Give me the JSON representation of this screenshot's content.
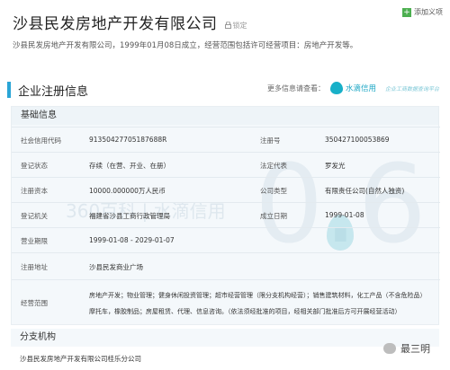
{
  "header": {
    "title": "沙县民发房地产开发有限公司",
    "lock_label": "锁定",
    "add_button": "添加义项",
    "intro": "沙县民发房地产开发有限公司，1999年01月08日成立，经营范围包括许可经营项目：房地产开发等。"
  },
  "section": {
    "title": "企业注册信息",
    "more_label": "更多信息请查看：",
    "brand": "水滴信用",
    "slogan": "企业工商数据查询平台"
  },
  "card": {
    "title": "基础信息",
    "rows": [
      {
        "l1": "社会信用代码",
        "v1": "91350427705187688R",
        "l2": "注册号",
        "v2": "350427100053869"
      },
      {
        "l1": "登记状态",
        "v1": "存续（在营、开业、在册）",
        "l2": "法定代表",
        "v2": "罗发光"
      },
      {
        "l1": "注册资本",
        "v1": "10000.000000万人民币",
        "l2": "公司类型",
        "v2": "有限责任公司(自然人独资)"
      },
      {
        "l1": "登记机关",
        "v1": "福建省沙县工商行政管理局",
        "l2": "成立日期",
        "v2": "1999-01-08"
      },
      {
        "l1": "营业期限",
        "v1": "1999-01-08 - 2029-01-07",
        "l2": "",
        "v2": ""
      },
      {
        "l1": "注册地址",
        "v1": "沙县民发商业广场",
        "l2": "",
        "v2": ""
      }
    ],
    "scope_label": "经营范围",
    "scope_line1": "房地产开发；物业管理；健身休闲投资管理；超市经营管理（限分支机构经营）；销售建筑材料，化工产品（不含危险品）",
    "scope_line2": "摩托车，橡胶制品；房屋租赁、代理、信息咨询。（依法须经批准的项目，经相关部门批准后方可开展经营活动）"
  },
  "watermark": {
    "text": "360百科 | 水滴信用",
    "num": "0.6"
  },
  "branch": {
    "title": "分支机构",
    "item": "沙县民发房地产开发有限公司桂乐分公司"
  },
  "wechat": {
    "name": "最三明"
  }
}
